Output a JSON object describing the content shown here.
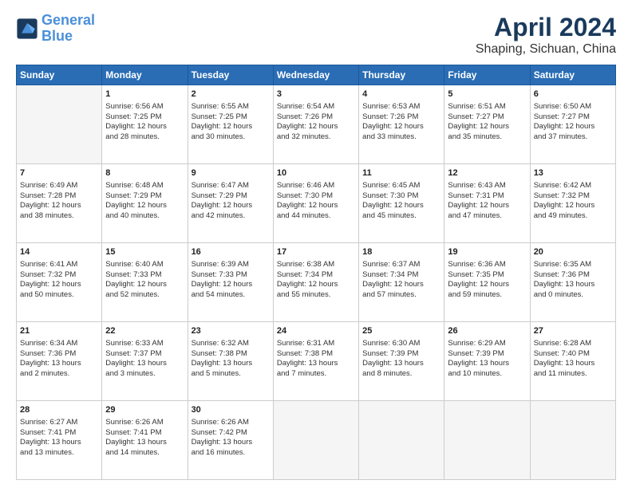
{
  "logo": {
    "line1": "General",
    "line2": "Blue"
  },
  "title": "April 2024",
  "location": "Shaping, Sichuan, China",
  "days_of_week": [
    "Sunday",
    "Monday",
    "Tuesday",
    "Wednesday",
    "Thursday",
    "Friday",
    "Saturday"
  ],
  "weeks": [
    [
      {
        "day": "",
        "content": ""
      },
      {
        "day": "1",
        "content": "Sunrise: 6:56 AM\nSunset: 7:25 PM\nDaylight: 12 hours\nand 28 minutes."
      },
      {
        "day": "2",
        "content": "Sunrise: 6:55 AM\nSunset: 7:25 PM\nDaylight: 12 hours\nand 30 minutes."
      },
      {
        "day": "3",
        "content": "Sunrise: 6:54 AM\nSunset: 7:26 PM\nDaylight: 12 hours\nand 32 minutes."
      },
      {
        "day": "4",
        "content": "Sunrise: 6:53 AM\nSunset: 7:26 PM\nDaylight: 12 hours\nand 33 minutes."
      },
      {
        "day": "5",
        "content": "Sunrise: 6:51 AM\nSunset: 7:27 PM\nDaylight: 12 hours\nand 35 minutes."
      },
      {
        "day": "6",
        "content": "Sunrise: 6:50 AM\nSunset: 7:27 PM\nDaylight: 12 hours\nand 37 minutes."
      }
    ],
    [
      {
        "day": "7",
        "content": "Sunrise: 6:49 AM\nSunset: 7:28 PM\nDaylight: 12 hours\nand 38 minutes."
      },
      {
        "day": "8",
        "content": "Sunrise: 6:48 AM\nSunset: 7:29 PM\nDaylight: 12 hours\nand 40 minutes."
      },
      {
        "day": "9",
        "content": "Sunrise: 6:47 AM\nSunset: 7:29 PM\nDaylight: 12 hours\nand 42 minutes."
      },
      {
        "day": "10",
        "content": "Sunrise: 6:46 AM\nSunset: 7:30 PM\nDaylight: 12 hours\nand 44 minutes."
      },
      {
        "day": "11",
        "content": "Sunrise: 6:45 AM\nSunset: 7:30 PM\nDaylight: 12 hours\nand 45 minutes."
      },
      {
        "day": "12",
        "content": "Sunrise: 6:43 AM\nSunset: 7:31 PM\nDaylight: 12 hours\nand 47 minutes."
      },
      {
        "day": "13",
        "content": "Sunrise: 6:42 AM\nSunset: 7:32 PM\nDaylight: 12 hours\nand 49 minutes."
      }
    ],
    [
      {
        "day": "14",
        "content": "Sunrise: 6:41 AM\nSunset: 7:32 PM\nDaylight: 12 hours\nand 50 minutes."
      },
      {
        "day": "15",
        "content": "Sunrise: 6:40 AM\nSunset: 7:33 PM\nDaylight: 12 hours\nand 52 minutes."
      },
      {
        "day": "16",
        "content": "Sunrise: 6:39 AM\nSunset: 7:33 PM\nDaylight: 12 hours\nand 54 minutes."
      },
      {
        "day": "17",
        "content": "Sunrise: 6:38 AM\nSunset: 7:34 PM\nDaylight: 12 hours\nand 55 minutes."
      },
      {
        "day": "18",
        "content": "Sunrise: 6:37 AM\nSunset: 7:34 PM\nDaylight: 12 hours\nand 57 minutes."
      },
      {
        "day": "19",
        "content": "Sunrise: 6:36 AM\nSunset: 7:35 PM\nDaylight: 12 hours\nand 59 minutes."
      },
      {
        "day": "20",
        "content": "Sunrise: 6:35 AM\nSunset: 7:36 PM\nDaylight: 13 hours\nand 0 minutes."
      }
    ],
    [
      {
        "day": "21",
        "content": "Sunrise: 6:34 AM\nSunset: 7:36 PM\nDaylight: 13 hours\nand 2 minutes."
      },
      {
        "day": "22",
        "content": "Sunrise: 6:33 AM\nSunset: 7:37 PM\nDaylight: 13 hours\nand 3 minutes."
      },
      {
        "day": "23",
        "content": "Sunrise: 6:32 AM\nSunset: 7:38 PM\nDaylight: 13 hours\nand 5 minutes."
      },
      {
        "day": "24",
        "content": "Sunrise: 6:31 AM\nSunset: 7:38 PM\nDaylight: 13 hours\nand 7 minutes."
      },
      {
        "day": "25",
        "content": "Sunrise: 6:30 AM\nSunset: 7:39 PM\nDaylight: 13 hours\nand 8 minutes."
      },
      {
        "day": "26",
        "content": "Sunrise: 6:29 AM\nSunset: 7:39 PM\nDaylight: 13 hours\nand 10 minutes."
      },
      {
        "day": "27",
        "content": "Sunrise: 6:28 AM\nSunset: 7:40 PM\nDaylight: 13 hours\nand 11 minutes."
      }
    ],
    [
      {
        "day": "28",
        "content": "Sunrise: 6:27 AM\nSunset: 7:41 PM\nDaylight: 13 hours\nand 13 minutes."
      },
      {
        "day": "29",
        "content": "Sunrise: 6:26 AM\nSunset: 7:41 PM\nDaylight: 13 hours\nand 14 minutes."
      },
      {
        "day": "30",
        "content": "Sunrise: 6:26 AM\nSunset: 7:42 PM\nDaylight: 13 hours\nand 16 minutes."
      },
      {
        "day": "",
        "content": ""
      },
      {
        "day": "",
        "content": ""
      },
      {
        "day": "",
        "content": ""
      },
      {
        "day": "",
        "content": ""
      }
    ]
  ]
}
